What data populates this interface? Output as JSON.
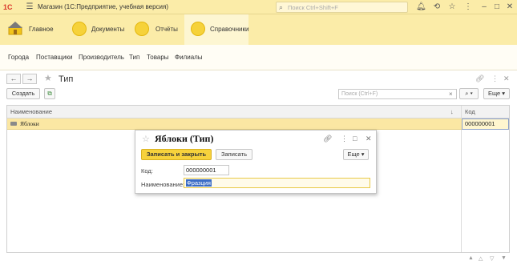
{
  "app": {
    "logo": "1С",
    "title": "Магазин  (1С:Предприятие, учебная версия)",
    "search_placeholder": "Поиск Ctrl+Shift+F"
  },
  "sections": [
    {
      "label": "Главное",
      "icon": "home-icon"
    },
    {
      "label": "Документы",
      "icon": "section-circle-icon"
    },
    {
      "label": "Отчёты",
      "icon": "section-circle-icon"
    },
    {
      "label": "Справочники",
      "icon": "section-circle-icon",
      "active": true
    }
  ],
  "functions": [
    "Города",
    "Поставщики",
    "Производитель",
    "Тип",
    "Товары",
    "Филиалы"
  ],
  "list_form": {
    "title": "Тип",
    "create_label": "Создать",
    "search_placeholder": "Поиск (Ctrl+F)",
    "more_label": "Еще",
    "columns": [
      "Наименование",
      "Код"
    ],
    "rows": [
      {
        "name": "Яблоки",
        "code": "000000001"
      }
    ]
  },
  "dialog": {
    "title": "Яблоки (Тип)",
    "save_close_label": "Записать и закрыть",
    "save_label": "Записать",
    "more_label": "Еще",
    "code_label": "Код:",
    "code_value": "000000001",
    "name_label": "Наименование:",
    "name_value": "Фразция"
  },
  "colors": {
    "panel": "#fbeca8",
    "accent": "#f7d23c",
    "selected_row": "#fbe7a3",
    "selection": "#3b6cc6"
  }
}
